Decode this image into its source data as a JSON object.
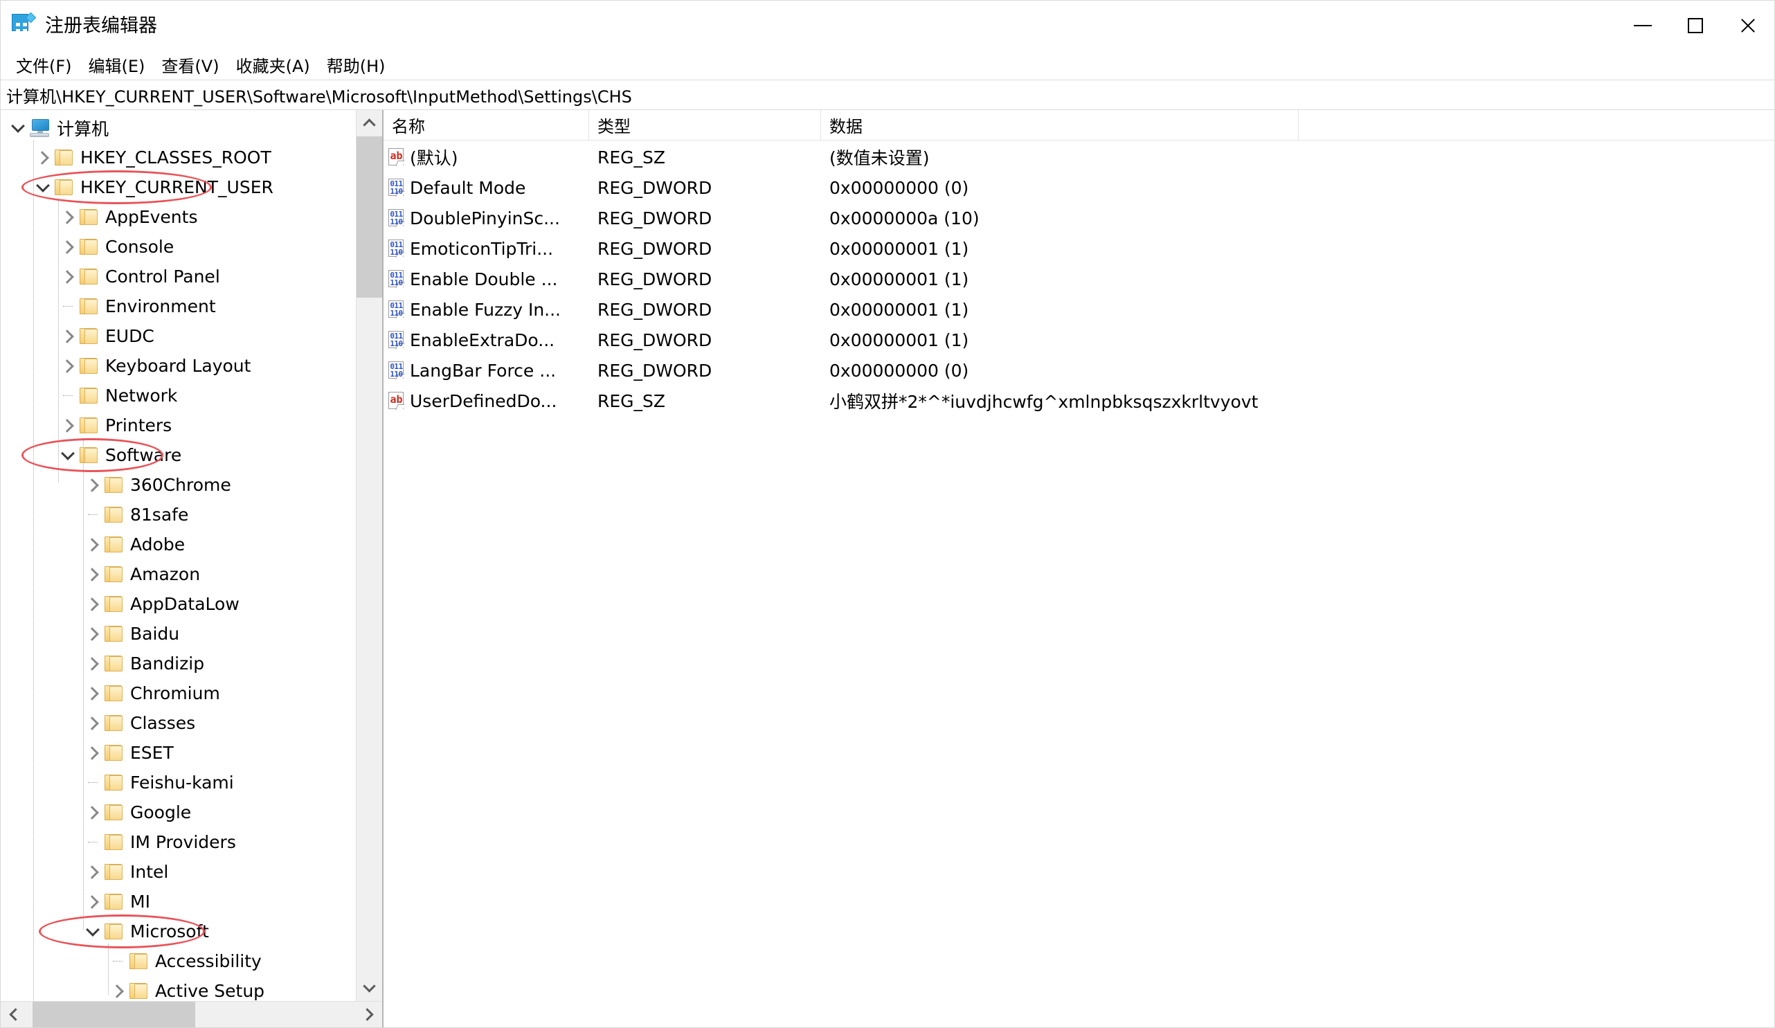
{
  "window": {
    "title": "注册表编辑器",
    "icon": "registry-editor-icon",
    "controls": {
      "minimize": "minimize-icon",
      "maximize": "maximize-icon",
      "close": "close-icon"
    }
  },
  "menubar": {
    "items": [
      {
        "label": "文件(F)"
      },
      {
        "label": "编辑(E)"
      },
      {
        "label": "查看(V)"
      },
      {
        "label": "收藏夹(A)"
      },
      {
        "label": "帮助(H)"
      }
    ]
  },
  "address": {
    "path": "计算机\\HKEY_CURRENT_USER\\Software\\Microsoft\\InputMethod\\Settings\\CHS"
  },
  "tree": {
    "nodes": [
      {
        "label": "计算机",
        "depth": 0,
        "icon": "computer-icon",
        "state": "expanded"
      },
      {
        "label": "HKEY_CLASSES_ROOT",
        "depth": 1,
        "icon": "folder-icon",
        "state": "collapsed"
      },
      {
        "label": "HKEY_CURRENT_USER",
        "depth": 1,
        "icon": "folder-icon",
        "state": "expanded",
        "highlighted": true
      },
      {
        "label": "AppEvents",
        "depth": 2,
        "icon": "folder-icon",
        "state": "collapsed"
      },
      {
        "label": "Console",
        "depth": 2,
        "icon": "folder-icon",
        "state": "collapsed"
      },
      {
        "label": "Control Panel",
        "depth": 2,
        "icon": "folder-icon",
        "state": "collapsed"
      },
      {
        "label": "Environment",
        "depth": 2,
        "icon": "folder-icon",
        "state": "leaf"
      },
      {
        "label": "EUDC",
        "depth": 2,
        "icon": "folder-icon",
        "state": "collapsed"
      },
      {
        "label": "Keyboard Layout",
        "depth": 2,
        "icon": "folder-icon",
        "state": "collapsed"
      },
      {
        "label": "Network",
        "depth": 2,
        "icon": "folder-icon",
        "state": "leaf"
      },
      {
        "label": "Printers",
        "depth": 2,
        "icon": "folder-icon",
        "state": "collapsed"
      },
      {
        "label": "Software",
        "depth": 2,
        "icon": "folder-icon",
        "state": "expanded",
        "highlighted": true
      },
      {
        "label": "360Chrome",
        "depth": 3,
        "icon": "folder-icon",
        "state": "collapsed"
      },
      {
        "label": "81safe",
        "depth": 3,
        "icon": "folder-icon",
        "state": "leaf"
      },
      {
        "label": "Adobe",
        "depth": 3,
        "icon": "folder-icon",
        "state": "collapsed"
      },
      {
        "label": "Amazon",
        "depth": 3,
        "icon": "folder-icon",
        "state": "collapsed"
      },
      {
        "label": "AppDataLow",
        "depth": 3,
        "icon": "folder-icon",
        "state": "collapsed"
      },
      {
        "label": "Baidu",
        "depth": 3,
        "icon": "folder-icon",
        "state": "collapsed"
      },
      {
        "label": "Bandizip",
        "depth": 3,
        "icon": "folder-icon",
        "state": "collapsed"
      },
      {
        "label": "Chromium",
        "depth": 3,
        "icon": "folder-icon",
        "state": "collapsed"
      },
      {
        "label": "Classes",
        "depth": 3,
        "icon": "folder-icon",
        "state": "collapsed"
      },
      {
        "label": "ESET",
        "depth": 3,
        "icon": "folder-icon",
        "state": "collapsed"
      },
      {
        "label": "Feishu-kami",
        "depth": 3,
        "icon": "folder-icon",
        "state": "leaf"
      },
      {
        "label": "Google",
        "depth": 3,
        "icon": "folder-icon",
        "state": "collapsed"
      },
      {
        "label": "IM Providers",
        "depth": 3,
        "icon": "folder-icon",
        "state": "leaf"
      },
      {
        "label": "Intel",
        "depth": 3,
        "icon": "folder-icon",
        "state": "collapsed"
      },
      {
        "label": "MI",
        "depth": 3,
        "icon": "folder-icon",
        "state": "collapsed"
      },
      {
        "label": "Microsoft",
        "depth": 3,
        "icon": "folder-icon",
        "state": "expanded",
        "highlighted": true
      },
      {
        "label": "Accessibility",
        "depth": 4,
        "icon": "folder-icon",
        "state": "leaf"
      },
      {
        "label": "Active Setup",
        "depth": 4,
        "icon": "folder-icon",
        "state": "collapsed"
      }
    ],
    "annotations": [
      {
        "target": "HKEY_CURRENT_USER",
        "shape": "ellipse",
        "color": "#e8545a"
      },
      {
        "target": "Software",
        "shape": "ellipse",
        "color": "#e8545a"
      },
      {
        "target": "Microsoft",
        "shape": "ellipse",
        "color": "#e8545a"
      }
    ]
  },
  "values": {
    "columns": [
      {
        "label": "名称"
      },
      {
        "label": "类型"
      },
      {
        "label": "数据"
      }
    ],
    "rows": [
      {
        "icon": "string-value-icon",
        "name": "(默认)",
        "type": "REG_SZ",
        "data": "(数值未设置)"
      },
      {
        "icon": "dword-value-icon",
        "name": "Default Mode",
        "type": "REG_DWORD",
        "data": "0x00000000 (0)"
      },
      {
        "icon": "dword-value-icon",
        "name": "DoublePinyinSc...",
        "type": "REG_DWORD",
        "data": "0x0000000a (10)"
      },
      {
        "icon": "dword-value-icon",
        "name": "EmoticonTipTri...",
        "type": "REG_DWORD",
        "data": "0x00000001 (1)"
      },
      {
        "icon": "dword-value-icon",
        "name": "Enable Double ...",
        "type": "REG_DWORD",
        "data": "0x00000001 (1)"
      },
      {
        "icon": "dword-value-icon",
        "name": "Enable Fuzzy In...",
        "type": "REG_DWORD",
        "data": "0x00000001 (1)"
      },
      {
        "icon": "dword-value-icon",
        "name": "EnableExtraDo...",
        "type": "REG_DWORD",
        "data": "0x00000001 (1)"
      },
      {
        "icon": "dword-value-icon",
        "name": "LangBar Force ...",
        "type": "REG_DWORD",
        "data": "0x00000000 (0)"
      },
      {
        "icon": "string-value-icon",
        "name": "UserDefinedDo...",
        "type": "REG_SZ",
        "data": "小鹤双拼*2*^*iuvdjhcwfg^xmlnpbksqszxkrltvyovt"
      }
    ]
  },
  "scrollbars": {
    "tree_vertical": {
      "up": "chevron-up-icon",
      "down": "chevron-down-icon"
    },
    "tree_horizontal": {
      "left": "chevron-left-icon",
      "right": "chevron-right-icon"
    }
  },
  "colors": {
    "annotation": "#e8545a",
    "folder": "#f5ce74",
    "reg_sz_icon": "#cc2a1e",
    "reg_dword_icon": "#2d52c9",
    "accent": "#2fa3e0"
  }
}
